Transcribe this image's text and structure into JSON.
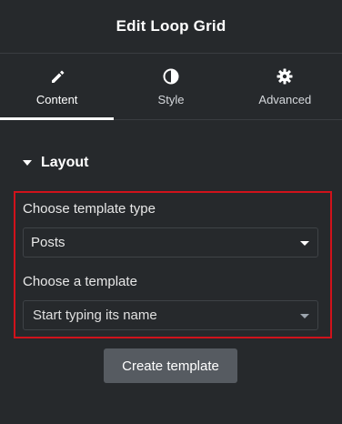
{
  "header": {
    "title": "Edit Loop Grid"
  },
  "tabs": [
    {
      "label": "Content",
      "icon": "pencil-icon",
      "active": true
    },
    {
      "label": "Style",
      "icon": "half-circle-icon",
      "active": false
    },
    {
      "label": "Advanced",
      "icon": "gear-icon",
      "active": false
    }
  ],
  "layout": {
    "section_title": "Layout",
    "template_type": {
      "label": "Choose template type",
      "value": "Posts"
    },
    "template": {
      "label": "Choose a template",
      "placeholder": "Start typing its name"
    },
    "create_button_label": "Create template"
  },
  "colors": {
    "background": "#26292c",
    "highlight_border": "#d0121b",
    "button_background": "#565b61"
  }
}
